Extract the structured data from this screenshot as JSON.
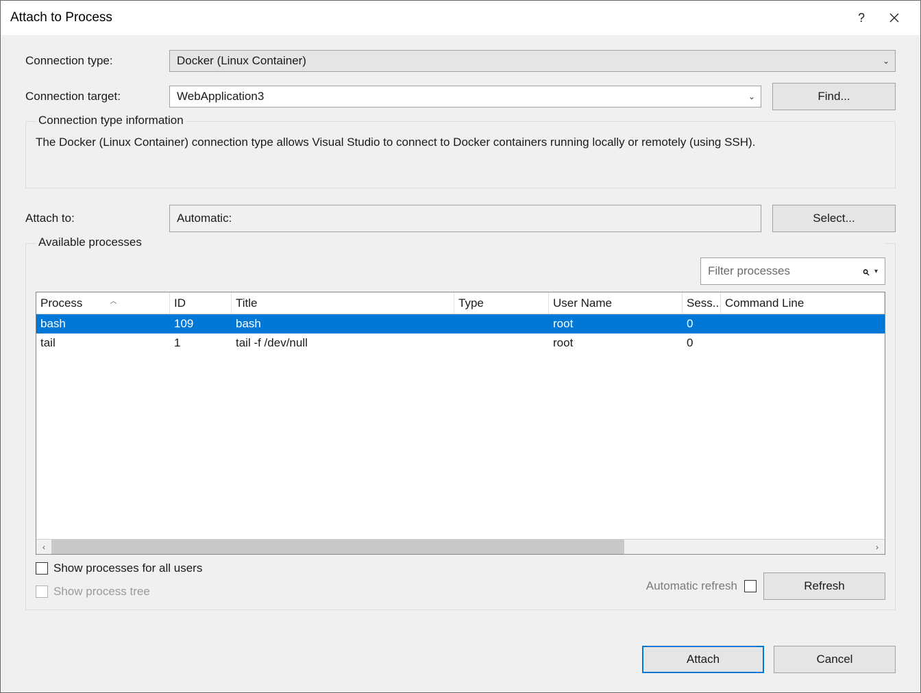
{
  "title": "Attach to Process",
  "labels": {
    "connectionType": "Connection type:",
    "connectionTarget": "Connection target:",
    "attachTo": "Attach to:",
    "infoLegend": "Connection type information",
    "availableLegend": "Available processes",
    "showAllUsers": "Show processes for all users",
    "showTree": "Show process tree",
    "autoRefresh": "Automatic refresh"
  },
  "values": {
    "connectionType": "Docker (Linux Container)",
    "connectionTarget": "WebApplication3",
    "attachTo": "Automatic:",
    "infoText": "The Docker (Linux Container) connection type allows Visual Studio to connect to Docker containers running locally or remotely (using SSH).",
    "filterPlaceholder": "Filter processes"
  },
  "buttons": {
    "find": "Find...",
    "select": "Select...",
    "refresh": "Refresh",
    "attach": "Attach",
    "cancel": "Cancel"
  },
  "columns": {
    "process": "Process",
    "id": "ID",
    "title": "Title",
    "type": "Type",
    "user": "User Name",
    "session": "Sess...",
    "cmd": "Command Line"
  },
  "processes": [
    {
      "process": "bash",
      "id": "109",
      "title": "bash",
      "type": "",
      "user": "root",
      "session": "0",
      "cmd": "",
      "selected": true
    },
    {
      "process": "tail",
      "id": "1",
      "title": "tail -f /dev/null",
      "type": "",
      "user": "root",
      "session": "0",
      "cmd": "",
      "selected": false
    }
  ]
}
